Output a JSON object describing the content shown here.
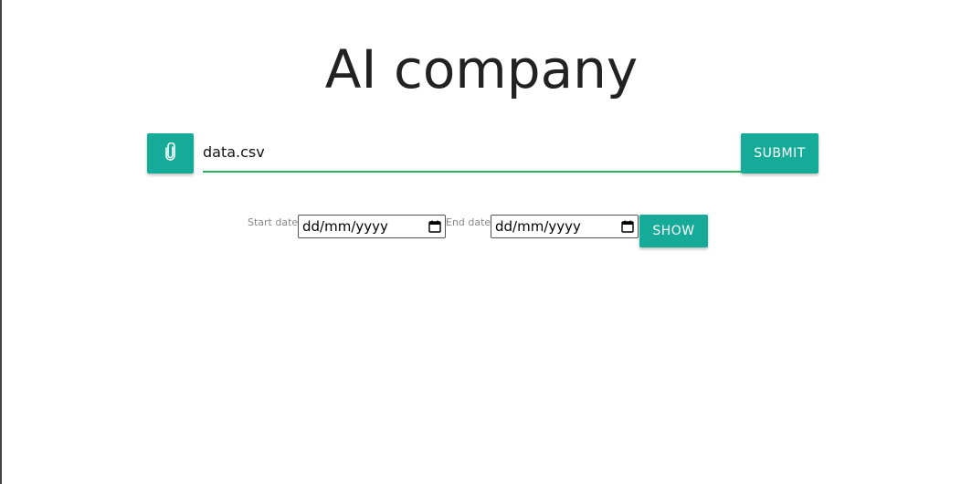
{
  "page": {
    "title": "AI company"
  },
  "upload": {
    "attach_icon": "paperclip-icon",
    "file_name": "data.csv",
    "submit_label": "SUBMIT"
  },
  "date_filter": {
    "start_label": "Start date:",
    "start_value": "dd/mm/yyyy",
    "end_label": "End date:",
    "end_value": "dd/mm/yyyy",
    "calendar_icon": "calendar-icon",
    "show_label": "SHOW"
  },
  "colors": {
    "accent": "#16ab98",
    "input_underline": "#27b55c",
    "title_text": "#222222"
  }
}
